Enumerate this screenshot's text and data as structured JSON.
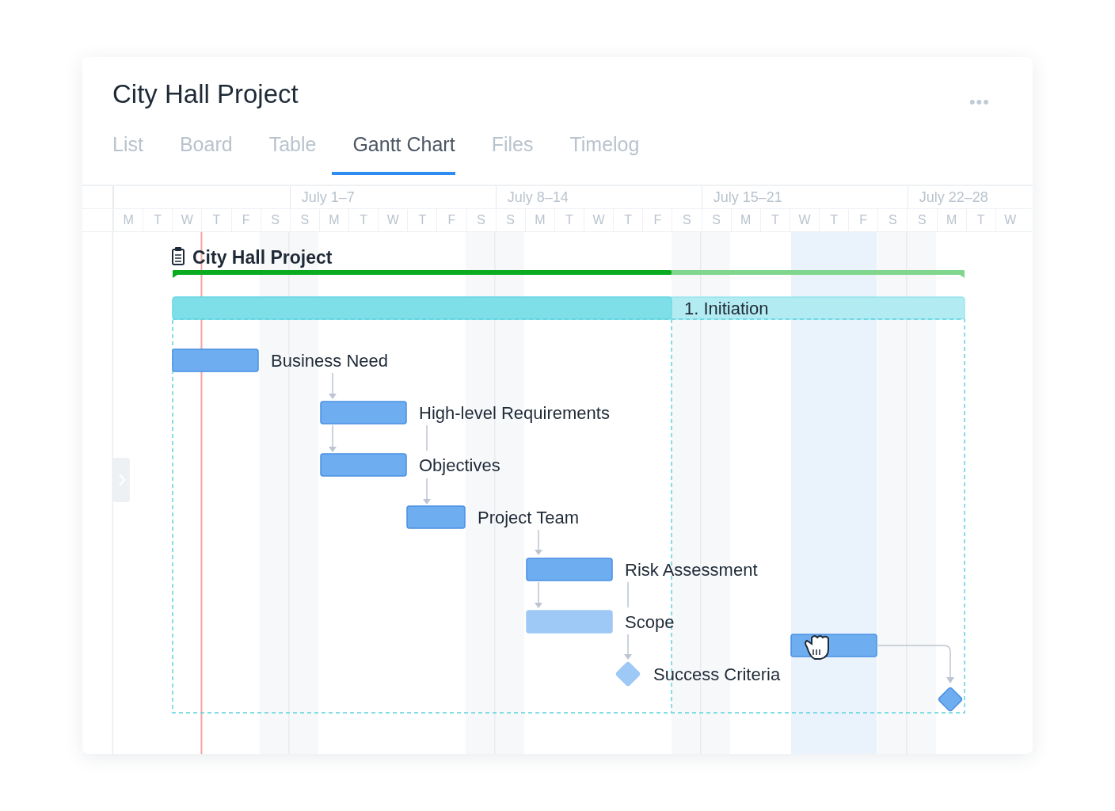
{
  "title": "City Hall Project",
  "menu_icon": "•••",
  "tabs": [
    {
      "label": "List",
      "selected": false
    },
    {
      "label": "Board",
      "selected": false
    },
    {
      "label": "Table",
      "selected": false
    },
    {
      "label": "Gantt Chart",
      "selected": true
    },
    {
      "label": "Files",
      "selected": false
    },
    {
      "label": "Timelog",
      "selected": false
    }
  ],
  "weeks": [
    "July 1–7",
    "July 8–14",
    "July 15–21",
    "July 22–28"
  ],
  "days": [
    "M",
    "T",
    "W",
    "T",
    "F",
    "S",
    "S",
    "M",
    "T",
    "W",
    "T",
    "F",
    "S",
    "S",
    "M",
    "T",
    "W",
    "T",
    "F",
    "S",
    "S",
    "M",
    "T",
    "W",
    "T",
    "F",
    "S",
    "S",
    "M",
    "T",
    "W"
  ],
  "today_line": true,
  "items": [
    {
      "kind": "project",
      "name": "City Hall Project",
      "level": 0.63
    },
    {
      "kind": "phase",
      "name": "1. Initiation",
      "level": 0.63
    },
    {
      "kind": "task",
      "name": "Business Need",
      "faded": false,
      "dragging": false
    },
    {
      "kind": "task",
      "name": "High-level Requirements",
      "faded": false,
      "dragging": false
    },
    {
      "kind": "task",
      "name": "Objectives",
      "faded": false,
      "dragging": false
    },
    {
      "kind": "task",
      "name": "Project Team",
      "faded": false,
      "dragging": false
    },
    {
      "kind": "task",
      "name": "Risk Assessment",
      "faded": false,
      "dragging": false
    },
    {
      "kind": "task",
      "name": "Scope",
      "faded": true,
      "dragging": false
    },
    {
      "kind": "milestone",
      "name": "Success Criteria",
      "faded": true
    },
    {
      "kind": "task",
      "faded": false,
      "dragging": true
    },
    {
      "kind": "milestone",
      "faded": false
    }
  ]
}
